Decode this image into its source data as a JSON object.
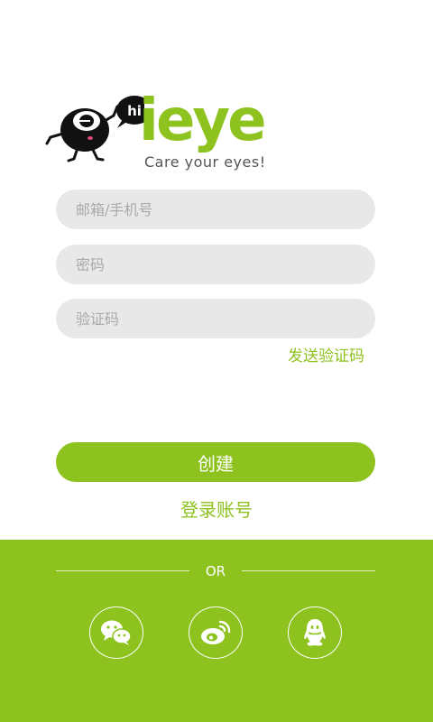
{
  "brand": {
    "badge": "hi",
    "wordmark": "ieye",
    "tagline": "Care your eyes!"
  },
  "form": {
    "account_placeholder": "邮箱/手机号",
    "password_placeholder": "密码",
    "code_placeholder": "验证码",
    "send_code_label": "发送验证码"
  },
  "actions": {
    "create_label": "创建",
    "login_label": "登录账号"
  },
  "social": {
    "divider_text": "OR",
    "providers": [
      "wechat-icon",
      "weibo-icon",
      "qq-icon"
    ]
  },
  "colors": {
    "accent": "#8dc21f",
    "field_bg": "#e8e8e8",
    "placeholder": "#a9a9a9"
  }
}
